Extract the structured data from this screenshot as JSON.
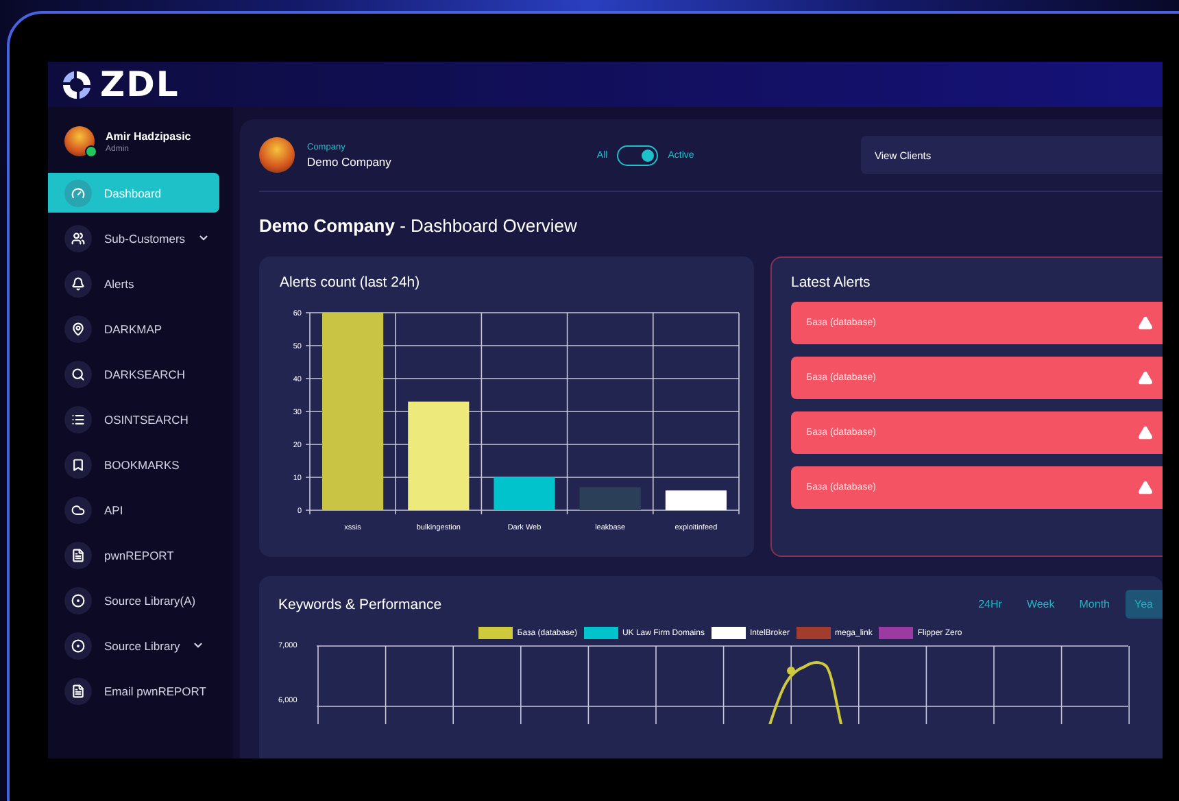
{
  "logo": {
    "text": "ZDL"
  },
  "user": {
    "name": "Amir Hadzipasic",
    "role": "Admin",
    "online": true
  },
  "sidebar": {
    "items": [
      {
        "label": "Dashboard",
        "selected": true,
        "submenu": false
      },
      {
        "label": "Sub-Customers",
        "selected": false,
        "submenu": true
      },
      {
        "label": "Alerts",
        "selected": false,
        "submenu": false
      },
      {
        "label": "DARKMAP",
        "selected": false,
        "submenu": false
      },
      {
        "label": "DARKSEARCH",
        "selected": false,
        "submenu": false
      },
      {
        "label": "OSINTSEARCH",
        "selected": false,
        "submenu": false
      },
      {
        "label": "BOOKMARKS",
        "selected": false,
        "submenu": false
      },
      {
        "label": "API",
        "selected": false,
        "submenu": false
      },
      {
        "label": "pwnREPORT",
        "selected": false,
        "submenu": false
      },
      {
        "label": "Source Library(A)",
        "selected": false,
        "submenu": false
      },
      {
        "label": "Source Library",
        "selected": false,
        "submenu": true
      },
      {
        "label": "Email pwnREPORT",
        "selected": false,
        "submenu": false
      }
    ]
  },
  "company": {
    "caption": "Company",
    "name": "Demo Company"
  },
  "filter": {
    "left_label": "All",
    "right_label": "Active",
    "on": true
  },
  "client_select": {
    "value": "View Clients"
  },
  "page_title": {
    "company": "Demo Company",
    "rest": " - Dashboard Overview"
  },
  "alerts_chart": {
    "chart_data": {
      "type": "bar",
      "grid": true,
      "title": "Alerts count (last 24h)",
      "categories": [
        "xssis",
        "bulkingestion",
        "Dark Web",
        "leakbase",
        "exploitinfeed"
      ],
      "values": [
        60,
        33,
        10,
        7,
        6
      ],
      "ylim": [
        0,
        60
      ],
      "yticks": [
        0,
        10,
        20,
        30,
        40,
        50,
        60
      ]
    }
  },
  "latest_alerts": {
    "title": "Latest Alerts",
    "items": [
      {
        "text": "База (database)"
      },
      {
        "text": "База (database)"
      },
      {
        "text": "База (database)"
      },
      {
        "text": "База (database)"
      }
    ]
  },
  "keywords": {
    "title": "Keywords & Performance",
    "ranges": [
      {
        "label": "24Hr",
        "selected": false
      },
      {
        "label": "Week",
        "selected": false
      },
      {
        "label": "Month",
        "selected": false
      },
      {
        "label": "Yea",
        "selected": true
      }
    ],
    "legend": [
      {
        "name": "База (database)",
        "color": "#cfc93c"
      },
      {
        "name": "UK Law Firm Domains",
        "color": "#00c3cb"
      },
      {
        "name": "IntelBroker",
        "color": "#ffffff"
      },
      {
        "name": "mega_link",
        "color": "#a23c2c"
      },
      {
        "name": "Flipper Zero",
        "color": "#9b3aa0"
      }
    ],
    "y_labels": [
      "7,000",
      "6,000"
    ]
  }
}
